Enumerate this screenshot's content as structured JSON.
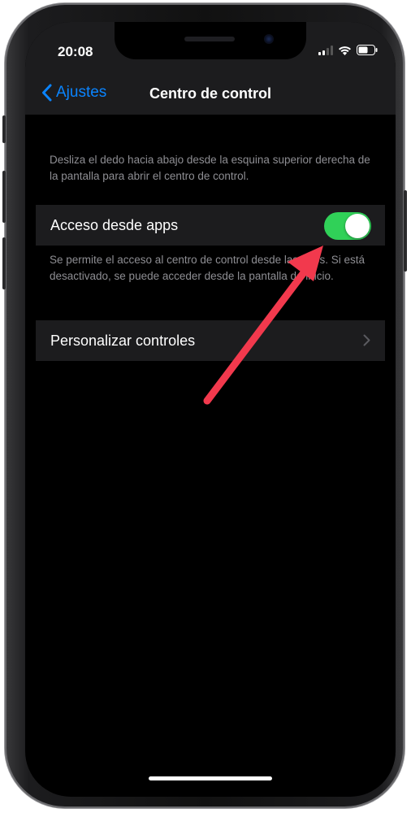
{
  "status_bar": {
    "time": "20:08",
    "icons": [
      "signal-icon",
      "wifi-icon",
      "battery-icon"
    ]
  },
  "nav": {
    "back_label": "Ajustes",
    "title": "Centro de control"
  },
  "intro_text": "Desliza el dedo hacia abajo desde la esquina superior derecha de la pantalla para abrir el centro de control.",
  "access_cell": {
    "label": "Acceso desde apps",
    "toggle_on": true,
    "footer": "Se permite el acceso al centro de control desde las apps. Si está desactivado, se puede acceder desde la pantalla de inicio."
  },
  "customize_cell": {
    "label": "Personalizar controles"
  },
  "colors": {
    "accent": "#0a84ff",
    "toggle_on": "#30d158",
    "annotation_arrow": "#f2394d"
  }
}
